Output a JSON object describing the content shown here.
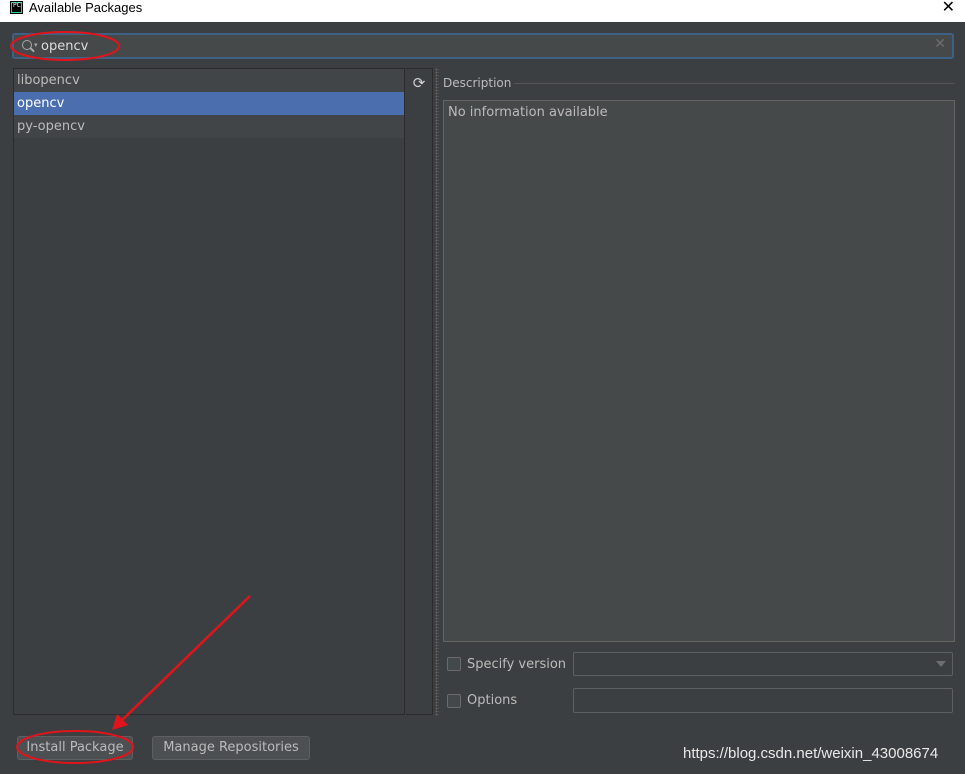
{
  "window": {
    "title": "Available Packages",
    "app_icon": "PC"
  },
  "search": {
    "value": "opencv",
    "placeholder": ""
  },
  "packages": [
    "libopencv",
    "opencv",
    "py-opencv"
  ],
  "selected_package": "opencv",
  "description": {
    "label": "Description",
    "text": "No information available"
  },
  "options": {
    "specify_version_label": "Specify version",
    "options_label": "Options"
  },
  "buttons": {
    "install": "Install Package",
    "manage": "Manage Repositories"
  },
  "watermark": "https://blog.csdn.net/weixin_43008674",
  "colors": {
    "selection": "#4b6eaf",
    "annotation": "#e0141a",
    "background": "#3c3f41"
  }
}
